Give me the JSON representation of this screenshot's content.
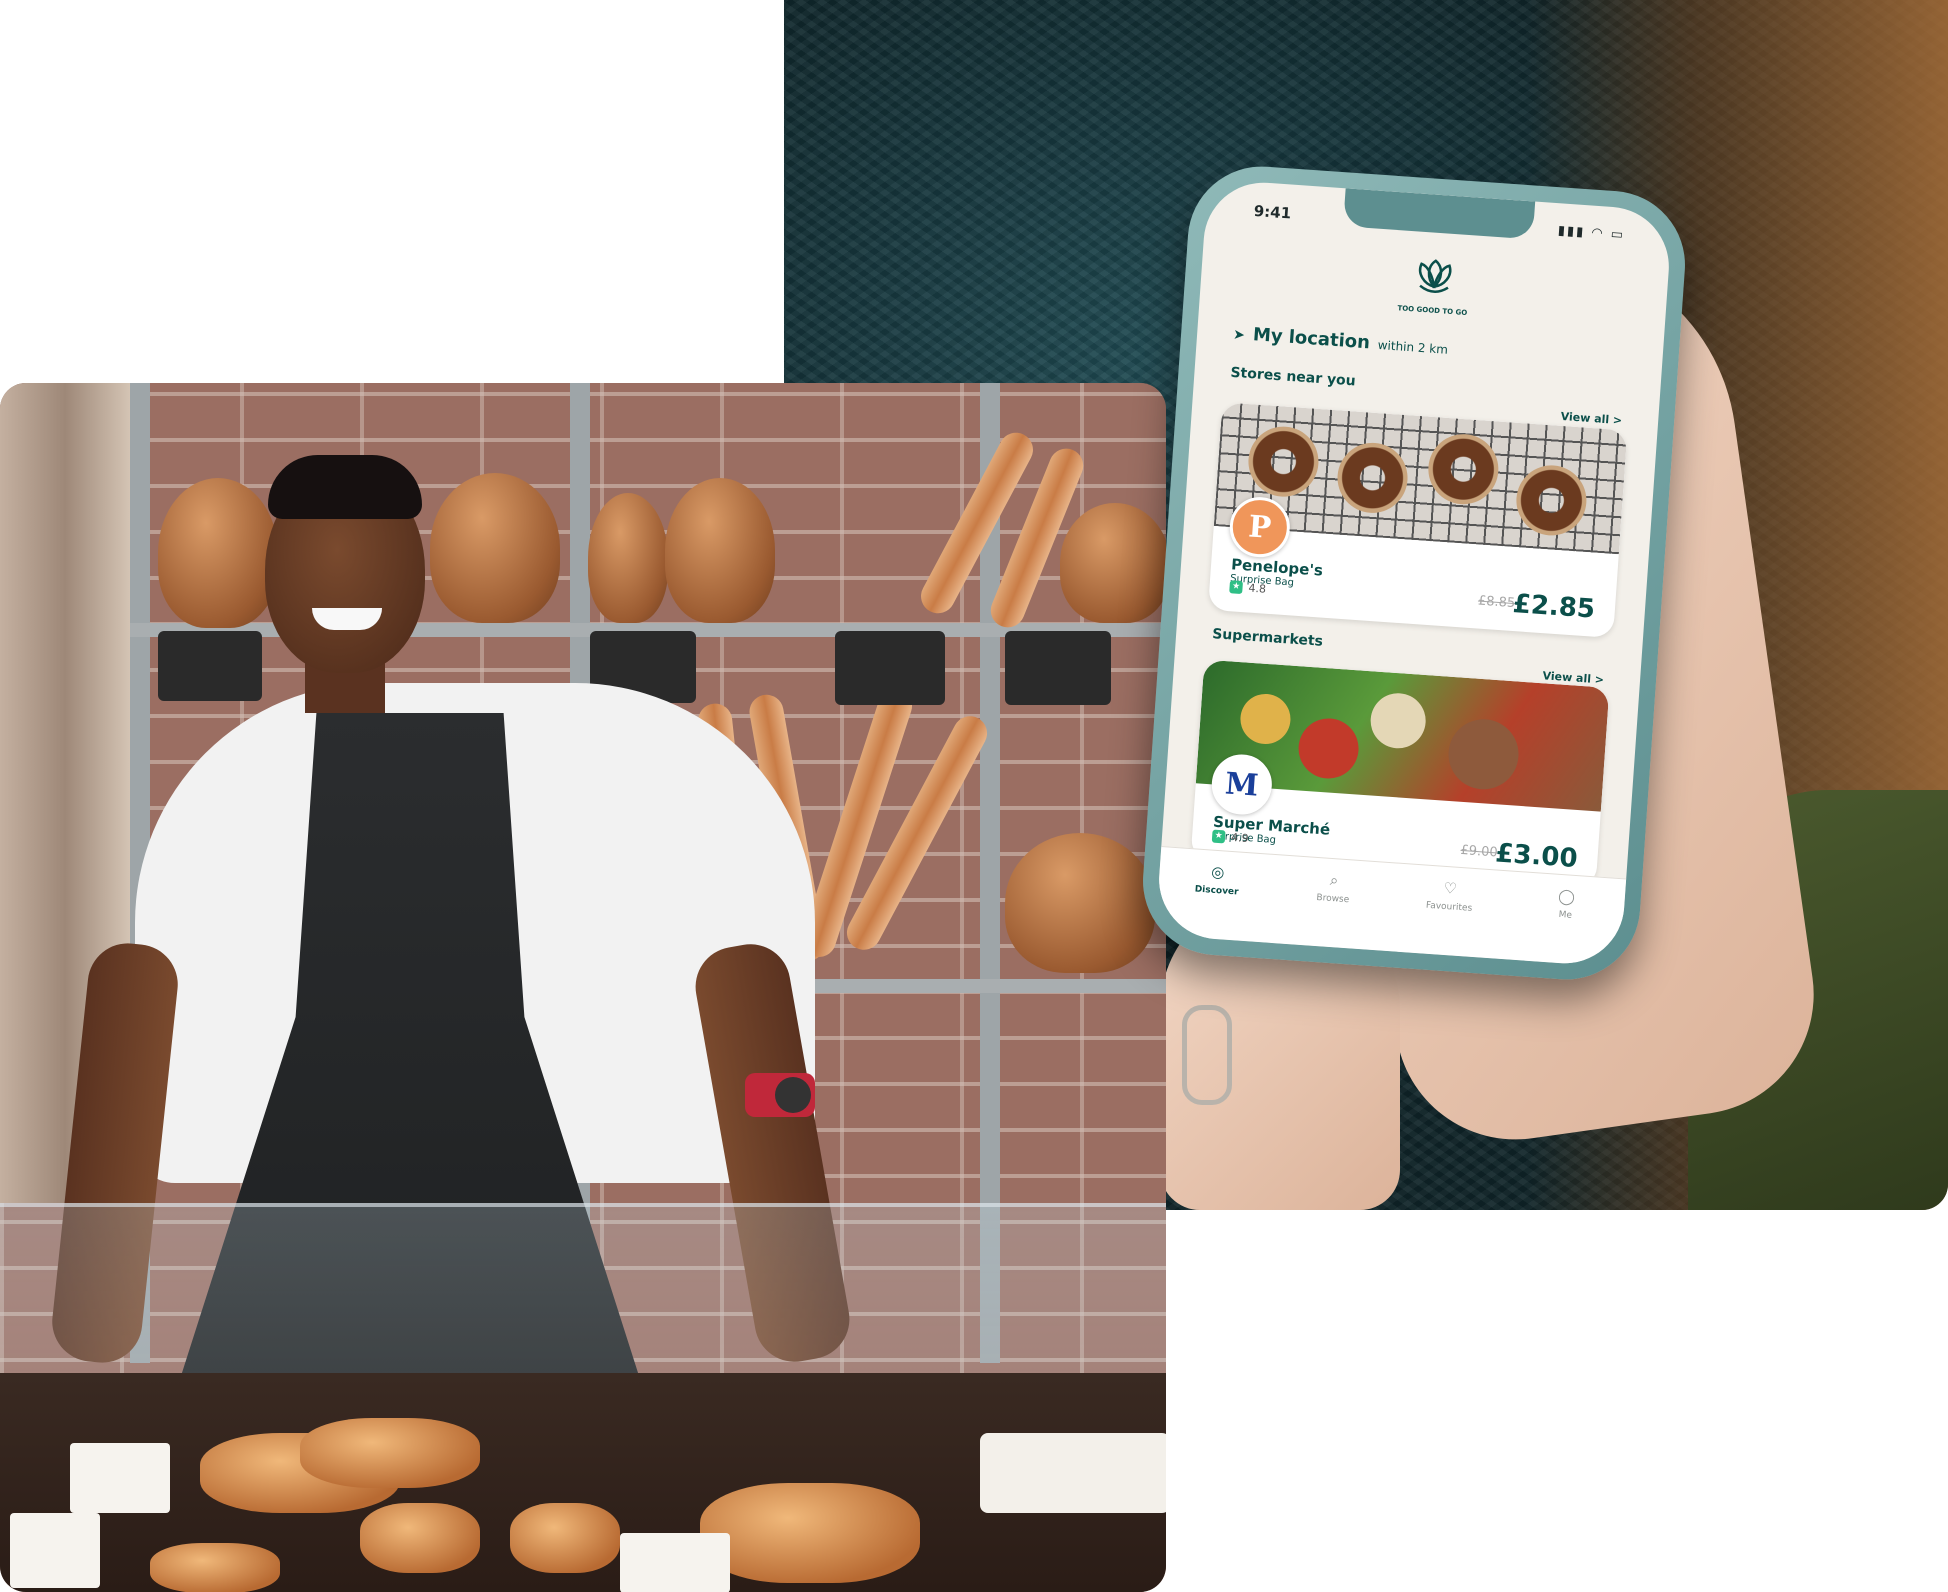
{
  "phone": {
    "status_time": "9:41",
    "brand_name": "TOO GOOD TO GO",
    "location_title": "My location",
    "location_radius": "within 2 km",
    "sections": [
      {
        "title": "Stores near you",
        "view_all": "View all >",
        "card": {
          "badge_letter": "P",
          "name": "Penelope's",
          "type": "Surprise Bag",
          "rating": "4.8",
          "old_price": "£8.85",
          "price": "£2.85"
        }
      },
      {
        "title": "Supermarkets",
        "view_all": "View all >",
        "card": {
          "badge_letter": "M",
          "name": "Super Marché",
          "type": "Surprise Bag",
          "rating": "4.9",
          "old_price": "£9.00",
          "price": "£3.00"
        }
      }
    ],
    "tabs": [
      {
        "label": "Discover",
        "icon": "compass-icon"
      },
      {
        "label": "Browse",
        "icon": "search-icon"
      },
      {
        "label": "Favourites",
        "icon": "heart-icon"
      },
      {
        "label": "Me",
        "icon": "profile-icon"
      }
    ]
  },
  "colors": {
    "brand_teal": "#0b4f4a",
    "screen_bg": "#f3f0ea",
    "frame_teal": "#5d8f90",
    "rating_green": "#2fbf86"
  }
}
